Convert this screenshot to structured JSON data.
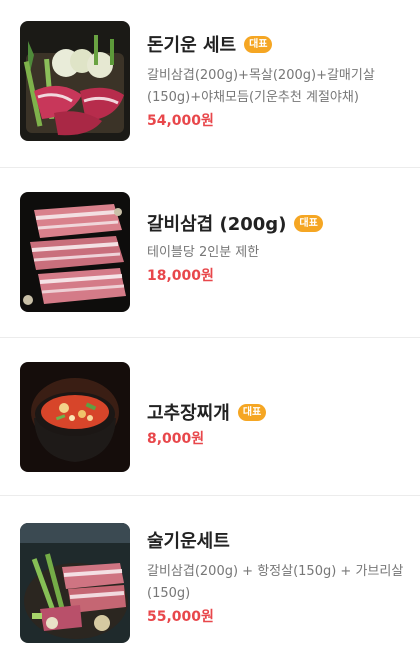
{
  "menu": {
    "items": [
      {
        "name": "돈기운 세트",
        "badge": "대표",
        "description": "갈비삼겹(200g)+목살(200g)+갈매기살(150g)+야채모듬(기운추천 계절야채)",
        "price": "54,000원"
      },
      {
        "name": "갈비삼겹 (200g)",
        "badge": "대표",
        "description": "테이블당 2인분 제한",
        "price": "18,000원"
      },
      {
        "name": "고추장찌개",
        "badge": "대표",
        "price": "8,000원"
      },
      {
        "name": "술기운세트",
        "description": "갈비삼겹(200g) + 항정살(150g) + 가브리살(150g)",
        "price": "55,000원"
      }
    ]
  },
  "colors": {
    "badge": "#f5a623",
    "price": "#e8474b",
    "name": "#222222",
    "description": "#777777"
  }
}
